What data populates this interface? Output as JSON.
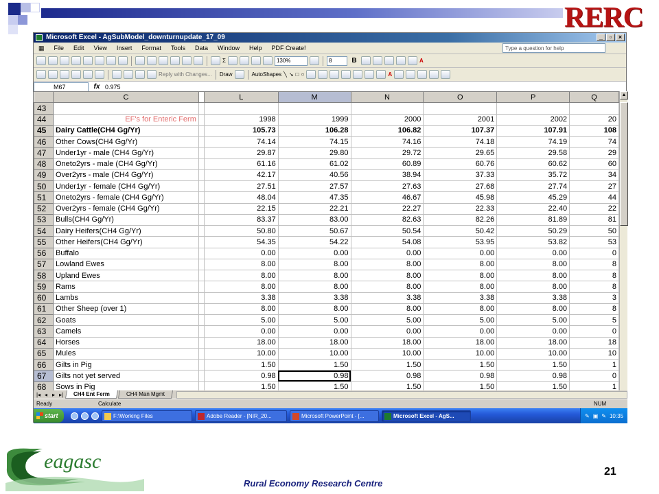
{
  "slide": {
    "brand_logo": "RERC",
    "footer_org": "Rural Economy Research Centre",
    "page_number": "21",
    "teagasc_logo_text": "eagasc"
  },
  "window": {
    "title": "Microsoft Excel - AgSubModel_downturnupdate_17_09",
    "menu": [
      "File",
      "Edit",
      "View",
      "Insert",
      "Format",
      "Tools",
      "Data",
      "Window",
      "Help",
      "PDF Create!"
    ],
    "ask_placeholder": "Type a question for help",
    "zoom": "130%",
    "font_size": "8",
    "reply_changes": "Reply with Changes...",
    "draw_label": "Draw",
    "autoshapes_label": "AutoShapes",
    "name_box": "M67",
    "formula_value": "0.975"
  },
  "sheet": {
    "columns": [
      "C",
      "L",
      "M",
      "N",
      "O",
      "P",
      "Q"
    ],
    "rows": [
      {
        "n": "43",
        "label": "",
        "vals": [
          "",
          "",
          "",
          "",
          "",
          ""
        ]
      },
      {
        "n": "44",
        "label": "EF's for Enteric Ferm",
        "vals": [
          "1998",
          "1999",
          "2000",
          "2001",
          "2002",
          "20"
        ],
        "type": "header"
      },
      {
        "n": "45",
        "label": "Dairy Cattle(CH4 Gg/Yr)",
        "vals": [
          "105.73",
          "106.28",
          "106.82",
          "107.37",
          "107.91",
          "108"
        ],
        "bold": true
      },
      {
        "n": "46",
        "label": "Other Cows(CH4 Gg/Yr)",
        "vals": [
          "74.14",
          "74.15",
          "74.16",
          "74.18",
          "74.19",
          "74"
        ]
      },
      {
        "n": "47",
        "label": "Under1yr -  male (CH4 Gg/Yr)",
        "vals": [
          "29.87",
          "29.80",
          "29.72",
          "29.65",
          "29.58",
          "29"
        ]
      },
      {
        "n": "48",
        "label": "Oneto2yrs  - male (CH4 Gg/Yr)",
        "vals": [
          "61.16",
          "61.02",
          "60.89",
          "60.76",
          "60.62",
          "60"
        ]
      },
      {
        "n": "49",
        "label": "Over2yrs -  male (CH4 Gg/Yr)",
        "vals": [
          "42.17",
          "40.56",
          "38.94",
          "37.33",
          "35.72",
          "34"
        ]
      },
      {
        "n": "50",
        "label": "Under1yr -  female (CH4 Gg/Yr)",
        "vals": [
          "27.51",
          "27.57",
          "27.63",
          "27.68",
          "27.74",
          "27"
        ]
      },
      {
        "n": "51",
        "label": "Oneto2yrs  - female (CH4 Gg/Yr)",
        "vals": [
          "48.04",
          "47.35",
          "46.67",
          "45.98",
          "45.29",
          "44"
        ]
      },
      {
        "n": "52",
        "label": "Over2yrs -  female (CH4 Gg/Yr)",
        "vals": [
          "22.15",
          "22.21",
          "22.27",
          "22.33",
          "22.40",
          "22"
        ]
      },
      {
        "n": "53",
        "label": "Bulls(CH4 Gg/Yr)",
        "vals": [
          "83.37",
          "83.00",
          "82.63",
          "82.26",
          "81.89",
          "81"
        ]
      },
      {
        "n": "54",
        "label": "Dairy Heifers(CH4 Gg/Yr)",
        "vals": [
          "50.80",
          "50.67",
          "50.54",
          "50.42",
          "50.29",
          "50"
        ]
      },
      {
        "n": "55",
        "label": "Other Heifers(CH4 Gg/Yr)",
        "vals": [
          "54.35",
          "54.22",
          "54.08",
          "53.95",
          "53.82",
          "53"
        ]
      },
      {
        "n": "56",
        "label": "Buffalo",
        "vals": [
          "0.00",
          "0.00",
          "0.00",
          "0.00",
          "0.00",
          "0"
        ]
      },
      {
        "n": "57",
        "label": "Lowland Ewes",
        "vals": [
          "8.00",
          "8.00",
          "8.00",
          "8.00",
          "8.00",
          "8"
        ]
      },
      {
        "n": "58",
        "label": "Upland Ewes",
        "vals": [
          "8.00",
          "8.00",
          "8.00",
          "8.00",
          "8.00",
          "8"
        ]
      },
      {
        "n": "59",
        "label": "Rams",
        "vals": [
          "8.00",
          "8.00",
          "8.00",
          "8.00",
          "8.00",
          "8"
        ]
      },
      {
        "n": "60",
        "label": "Lambs",
        "vals": [
          "3.38",
          "3.38",
          "3.38",
          "3.38",
          "3.38",
          "3"
        ]
      },
      {
        "n": "61",
        "label": "Other Sheep (over 1)",
        "vals": [
          "8.00",
          "8.00",
          "8.00",
          "8.00",
          "8.00",
          "8"
        ]
      },
      {
        "n": "62",
        "label": "Goats",
        "vals": [
          "5.00",
          "5.00",
          "5.00",
          "5.00",
          "5.00",
          "5"
        ]
      },
      {
        "n": "63",
        "label": "Camels",
        "vals": [
          "0.00",
          "0.00",
          "0.00",
          "0.00",
          "0.00",
          "0"
        ]
      },
      {
        "n": "64",
        "label": "Horses",
        "vals": [
          "18.00",
          "18.00",
          "18.00",
          "18.00",
          "18.00",
          "18"
        ]
      },
      {
        "n": "65",
        "label": "Mules",
        "vals": [
          "10.00",
          "10.00",
          "10.00",
          "10.00",
          "10.00",
          "10"
        ]
      },
      {
        "n": "66",
        "label": "Gilts in Pig",
        "vals": [
          "1.50",
          "1.50",
          "1.50",
          "1.50",
          "1.50",
          "1"
        ]
      },
      {
        "n": "67",
        "label": "Gilts not yet served",
        "vals": [
          "0.98",
          "0.98",
          "0.98",
          "0.98",
          "0.98",
          "0"
        ],
        "active": true
      },
      {
        "n": "68",
        "label": "Sows in Pig",
        "vals": [
          "1.50",
          "1.50",
          "1.50",
          "1.50",
          "1.50",
          "1"
        ]
      }
    ],
    "tabs": [
      "CH4 Ent Ferm",
      "CH4 Man Mgmt"
    ]
  },
  "status": {
    "ready": "Ready",
    "calculate": "Calculate",
    "num": "NUM"
  },
  "taskbar": {
    "start": "start",
    "items": [
      {
        "label": "F:\\Working Files",
        "color": "#f3c94d"
      },
      {
        "label": "Adobe Reader - [NIR_20...",
        "color": "#c0272d"
      },
      {
        "label": "Microsoft PowerPoint - [...",
        "color": "#d24726"
      },
      {
        "label": "Microsoft Excel - AgS...",
        "color": "#1e7a2e",
        "active": true
      }
    ],
    "clock": "10:35"
  },
  "colors": {
    "ef_label": "#e26b6b",
    "brand_red": "#b61414",
    "footer_blue": "#1a237e",
    "teagasc_green": "#2e7d32"
  }
}
